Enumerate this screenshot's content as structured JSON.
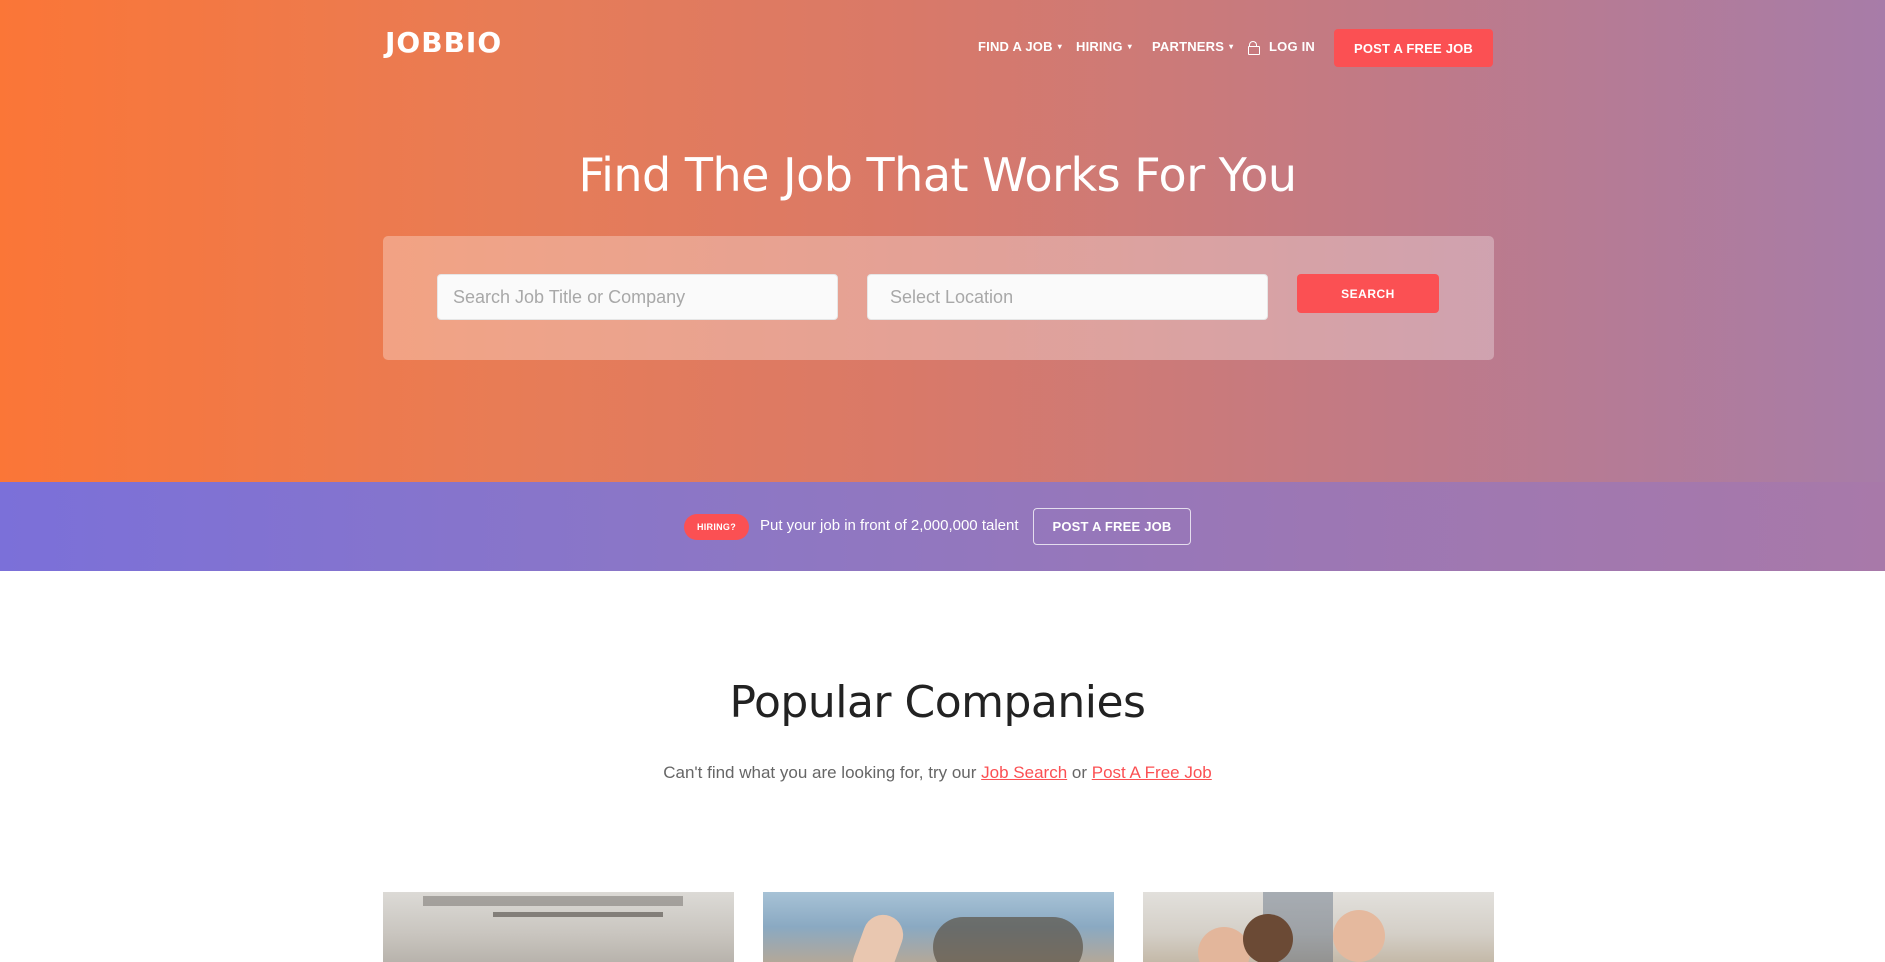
{
  "header": {
    "logo": "JOBBIO",
    "nav": [
      {
        "label": "FIND A JOB",
        "caret": "▾"
      },
      {
        "label": "HIRING",
        "caret": "▾"
      },
      {
        "label": "PARTNERS",
        "caret": "▾"
      }
    ],
    "login_label": "LOG IN",
    "post_job_label": "POST A FREE JOB"
  },
  "hero": {
    "title": "Find The Job That Works For You",
    "job_placeholder": "Search Job Title or Company",
    "location_placeholder": "Select Location",
    "search_label": "SEARCH"
  },
  "band": {
    "badge": "HIRING?",
    "text": "Put your job in front of 2,000,000 talent",
    "button_label": "POST A FREE JOB"
  },
  "companies": {
    "title": "Popular Companies",
    "subtitle_prefix": "Can't find what you are looking for, try our",
    "link_job_search": "Job Search",
    "connector": "or",
    "link_post_job": "Post A Free Job"
  },
  "colors": {
    "accent": "#fb5053",
    "hero_gradient_start": "#fb7637",
    "hero_gradient_end": "#a77ca8",
    "band_gradient_start": "#7b70d9"
  }
}
